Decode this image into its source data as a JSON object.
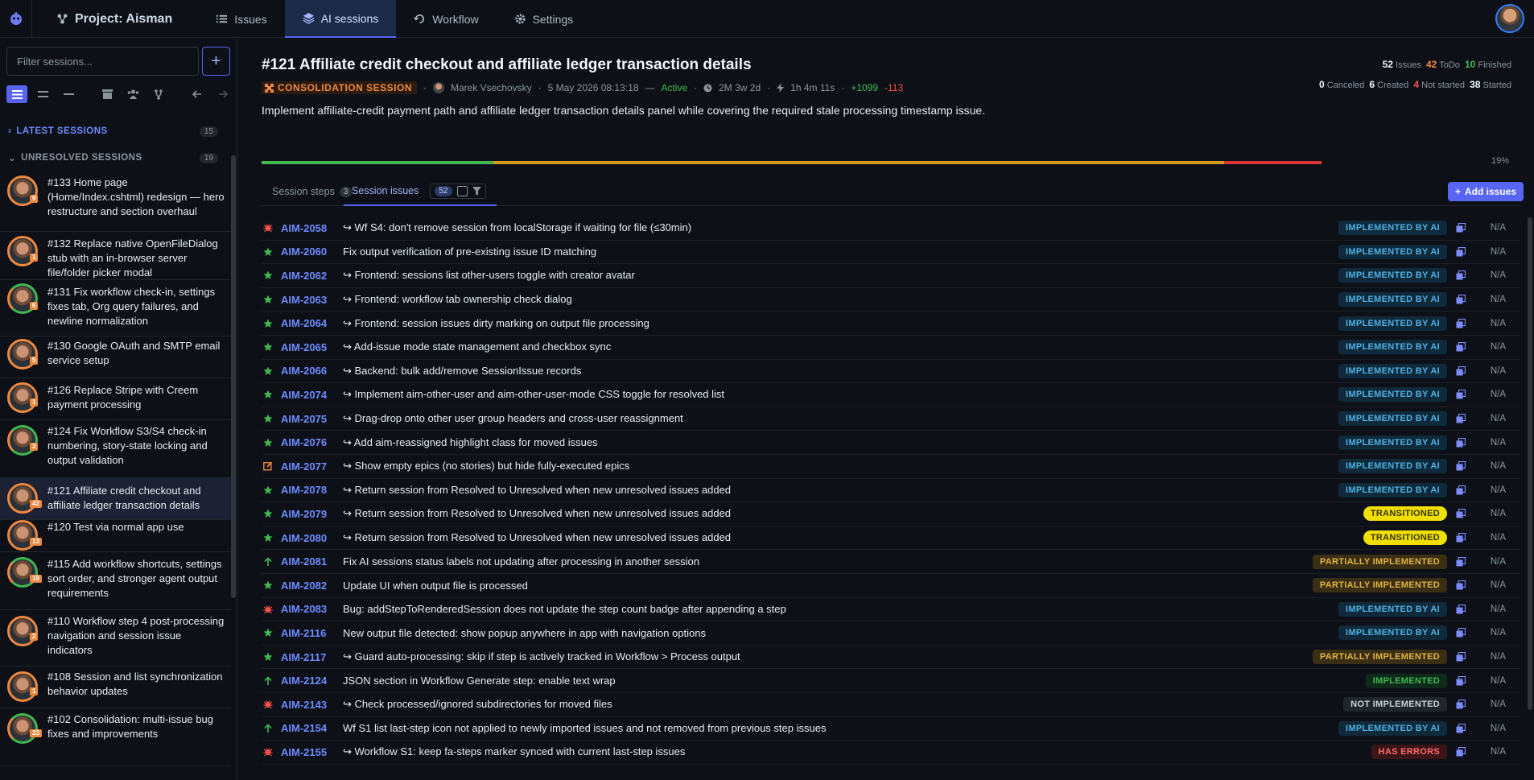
{
  "nav": {
    "project": "Project: Aisman",
    "items": [
      {
        "label": "Issues",
        "icon": "list-icon"
      },
      {
        "label": "AI sessions",
        "icon": "layers-icon",
        "active": true
      },
      {
        "label": "Workflow",
        "icon": "workflow-icon"
      },
      {
        "label": "Settings",
        "icon": "gear-icon"
      }
    ]
  },
  "sidebar": {
    "filter_placeholder": "Filter sessions...",
    "latest": {
      "label": "LATEST SESSIONS",
      "count": "15"
    },
    "unresolved": {
      "label": "UNRESOLVED SESSIONS",
      "count": "19"
    },
    "sessions": [
      {
        "title": "#133 Home page (Home/Index.cshtml) redesign — hero restructure and section overhaul",
        "badge": "9"
      },
      {
        "title": "#132 Replace native OpenFileDialog stub with an in-browser server file/folder picker modal",
        "badge": "1"
      },
      {
        "title": "#131 Fix workflow check-in, settings fixes tab, Org query failures, and newline normalization",
        "badge": "6"
      },
      {
        "title": "#130 Google OAuth and SMTP email service setup",
        "badge": "5"
      },
      {
        "title": "#126 Replace Stripe with Creem payment processing",
        "badge": "1"
      },
      {
        "title": "#124 Fix Workflow S3/S4 check-in numbering, story-state locking and output validation",
        "badge": "3"
      },
      {
        "title": "#121 Affiliate credit checkout and affiliate ledger transaction details",
        "badge": "42"
      },
      {
        "title": "#120 Test via normal app use",
        "badge": "13"
      },
      {
        "title": "#115 Add workflow shortcuts, settings sort order, and stronger agent output requirements",
        "badge": "18"
      },
      {
        "title": "#110 Workflow step 4 post-processing navigation and session issue indicators",
        "badge": "2"
      },
      {
        "title": "#108 Session and list synchronization behavior updates",
        "badge": "1"
      },
      {
        "title": "#102 Consolidation: multi-issue bug fixes and improvements",
        "badge": "23"
      }
    ]
  },
  "session": {
    "title": "#121 Affiliate credit checkout and affiliate ledger transaction details",
    "type": "CONSOLIDATION SESSION",
    "author": "Marek Vsechovsky",
    "date": "5 May 2026 08:13:18",
    "status": "Active",
    "age": "2M 3w 2d",
    "duration": "1h 4m 11s",
    "added": "+1099",
    "removed": "-113",
    "description": "Implement affiliate-credit payment path and affiliate ledger transaction details panel while covering the required stale processing timestamp issue.",
    "progress_pct": "19%",
    "progress": {
      "green": 0.19,
      "orange": 0.6,
      "red": 0.08
    }
  },
  "stats": {
    "issues": "52",
    "issues_label": "Issues",
    "todo": "42",
    "todo_label": "ToDo",
    "finished": "10",
    "finished_label": "Finished",
    "canceled": "0",
    "canceled_label": "Canceled",
    "created": "6",
    "created_label": "Created",
    "not_started": "4",
    "not_started_label": "Not started",
    "started": "38",
    "started_label": "Started"
  },
  "tabs": {
    "steps_label": "Session steps",
    "steps_count": "3",
    "issues_label": "Session issues",
    "issues_count": "52",
    "add_label": "Add issues"
  },
  "issues": [
    {
      "key": "AIM-2058",
      "title": "↪ Wf S4: don't remove session from localStorage if waiting for file (≤30min)",
      "status": "IMPLEMENTED BY AI",
      "kind": "ai",
      "icon": "bug"
    },
    {
      "key": "AIM-2060",
      "title": "Fix output verification of pre-existing issue ID matching",
      "status": "IMPLEMENTED BY AI",
      "kind": "ai",
      "icon": "star"
    },
    {
      "key": "AIM-2062",
      "title": "↪ Frontend: sessions list other-users toggle with creator avatar",
      "status": "IMPLEMENTED BY AI",
      "kind": "ai",
      "icon": "star"
    },
    {
      "key": "AIM-2063",
      "title": "↪ Frontend: workflow tab ownership check dialog",
      "status": "IMPLEMENTED BY AI",
      "kind": "ai",
      "icon": "star"
    },
    {
      "key": "AIM-2064",
      "title": "↪ Frontend: session issues dirty marking on output file processing",
      "status": "IMPLEMENTED BY AI",
      "kind": "ai",
      "icon": "star"
    },
    {
      "key": "AIM-2065",
      "title": "↪ Add-issue mode state management and checkbox sync",
      "status": "IMPLEMENTED BY AI",
      "kind": "ai",
      "icon": "star"
    },
    {
      "key": "AIM-2066",
      "title": "↪ Backend: bulk add/remove SessionIssue records",
      "status": "IMPLEMENTED BY AI",
      "kind": "ai",
      "icon": "star"
    },
    {
      "key": "AIM-2074",
      "title": "↪ Implement aim-other-user and aim-other-user-mode CSS toggle for resolved list",
      "status": "IMPLEMENTED BY AI",
      "kind": "ai",
      "icon": "star"
    },
    {
      "key": "AIM-2075",
      "title": "↪ Drag-drop onto other user group headers and cross-user reassignment",
      "status": "IMPLEMENTED BY AI",
      "kind": "ai",
      "icon": "star"
    },
    {
      "key": "AIM-2076",
      "title": "↪ Add aim-reassigned highlight class for moved issues",
      "status": "IMPLEMENTED BY AI",
      "kind": "ai",
      "icon": "star"
    },
    {
      "key": "AIM-2077",
      "title": "↪ Show empty epics (no stories) but hide fully-executed epics",
      "status": "IMPLEMENTED BY AI",
      "kind": "ai",
      "icon": "edit"
    },
    {
      "key": "AIM-2078",
      "title": "↪ Return session from Resolved to Unresolved when new unresolved issues added",
      "status": "IMPLEMENTED BY AI",
      "kind": "ai",
      "icon": "star"
    },
    {
      "key": "AIM-2079",
      "title": "↪ Return session from Resolved to Unresolved when new unresolved issues added",
      "status": "TRANSITIONED",
      "kind": "tr",
      "icon": "star"
    },
    {
      "key": "AIM-2080",
      "title": "↪ Return session from Resolved to Unresolved when new unresolved issues added",
      "status": "TRANSITIONED",
      "kind": "tr",
      "icon": "star"
    },
    {
      "key": "AIM-2081",
      "title": "Fix AI sessions status labels not updating after processing in another session",
      "status": "PARTIALLY IMPLEMENTED",
      "kind": "pi",
      "icon": "up"
    },
    {
      "key": "AIM-2082",
      "title": "Update UI when output file is processed",
      "status": "PARTIALLY IMPLEMENTED",
      "kind": "pi",
      "icon": "star"
    },
    {
      "key": "AIM-2083",
      "title": "Bug: addStepToRenderedSession does not update the step count badge after appending a step",
      "status": "IMPLEMENTED BY AI",
      "kind": "ai",
      "icon": "bug"
    },
    {
      "key": "AIM-2116",
      "title": "New output file detected: show popup anywhere in app with navigation options",
      "status": "IMPLEMENTED BY AI",
      "kind": "ai",
      "icon": "star"
    },
    {
      "key": "AIM-2117",
      "title": "↪ Guard auto-processing: skip if step is actively tracked in Workflow > Process output",
      "status": "PARTIALLY IMPLEMENTED",
      "kind": "pi",
      "icon": "star"
    },
    {
      "key": "AIM-2124",
      "title": "JSON section in Workflow Generate step: enable text wrap",
      "status": "IMPLEMENTED",
      "kind": "im",
      "icon": "up"
    },
    {
      "key": "AIM-2143",
      "title": "↪ Check processed/ignored subdirectories for moved files",
      "status": "NOT IMPLEMENTED",
      "kind": "ni",
      "icon": "bug"
    },
    {
      "key": "AIM-2154",
      "title": "Wf S1 list last-step icon not applied to newly imported issues and not removed from previous step issues",
      "status": "IMPLEMENTED BY AI",
      "kind": "ai",
      "icon": "up"
    },
    {
      "key": "AIM-2155",
      "title": "↪ Workflow S1: keep fa-steps marker synced with current last-step issues",
      "status": "HAS ERRORS",
      "kind": "err",
      "icon": "bug"
    }
  ],
  "na_label": "N/A",
  "colors": {
    "accent": "#5865f2",
    "green": "#3fb950",
    "orange": "#f0883e",
    "red": "#f85149",
    "link": "#6f8bff"
  }
}
